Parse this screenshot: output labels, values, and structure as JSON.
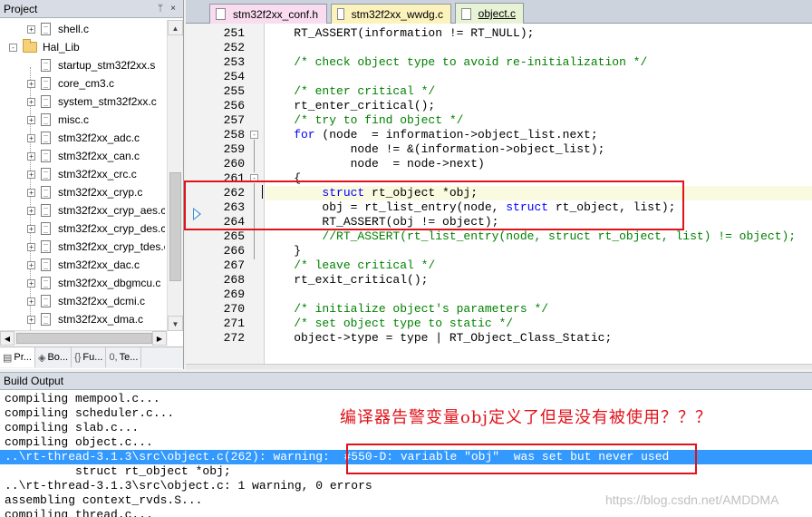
{
  "project_panel": {
    "title": "Project",
    "pin_glyph": "ᛘ",
    "close_glyph": "×",
    "tree": [
      {
        "label": "shell.c",
        "kind": "file",
        "expander": "+"
      },
      {
        "label": "Hal_Lib",
        "kind": "folder",
        "expander": "−"
      },
      {
        "label": "startup_stm32f2xx.s",
        "kind": "file",
        "expander": ""
      },
      {
        "label": "core_cm3.c",
        "kind": "file",
        "expander": "+"
      },
      {
        "label": "system_stm32f2xx.c",
        "kind": "file",
        "expander": "+"
      },
      {
        "label": "misc.c",
        "kind": "file",
        "expander": "+"
      },
      {
        "label": "stm32f2xx_adc.c",
        "kind": "file",
        "expander": "+"
      },
      {
        "label": "stm32f2xx_can.c",
        "kind": "file",
        "expander": "+"
      },
      {
        "label": "stm32f2xx_crc.c",
        "kind": "file",
        "expander": "+"
      },
      {
        "label": "stm32f2xx_cryp.c",
        "kind": "file",
        "expander": "+"
      },
      {
        "label": "stm32f2xx_cryp_aes.c",
        "kind": "file",
        "expander": "+"
      },
      {
        "label": "stm32f2xx_cryp_des.c",
        "kind": "file",
        "expander": "+"
      },
      {
        "label": "stm32f2xx_cryp_tdes.c",
        "kind": "file",
        "expander": "+"
      },
      {
        "label": "stm32f2xx_dac.c",
        "kind": "file",
        "expander": "+"
      },
      {
        "label": "stm32f2xx_dbgmcu.c",
        "kind": "file",
        "expander": "+"
      },
      {
        "label": "stm32f2xx_dcmi.c",
        "kind": "file",
        "expander": "+"
      },
      {
        "label": "stm32f2xx_dma.c",
        "kind": "file",
        "expander": "+"
      }
    ],
    "tabs": [
      {
        "label": "Pr...",
        "icon": "▤"
      },
      {
        "label": "Bo...",
        "icon": "◈"
      },
      {
        "label": "Fu...",
        "icon": "{}"
      },
      {
        "label": "Te...",
        "icon": "0,"
      }
    ]
  },
  "editor": {
    "tabs": [
      {
        "label": "stm32f2xx_conf.h",
        "color": "#f9dcef",
        "active": false
      },
      {
        "label": "stm32f2xx_wwdg.c",
        "color": "#fbf2bc",
        "active": false
      },
      {
        "label": "object.c",
        "color": "#e7f3d4",
        "active": true
      }
    ],
    "lines": [
      {
        "n": "251",
        "parts": [
          [
            "",
            "    RT_ASSERT(information != RT_NULL);"
          ]
        ]
      },
      {
        "n": "252",
        "parts": [
          [
            "",
            ""
          ]
        ]
      },
      {
        "n": "253",
        "parts": [
          [
            "cm",
            "    /* check object type to avoid re-initialization */"
          ]
        ]
      },
      {
        "n": "254",
        "parts": [
          [
            "",
            ""
          ]
        ]
      },
      {
        "n": "255",
        "parts": [
          [
            "cm",
            "    /* enter critical */"
          ]
        ]
      },
      {
        "n": "256",
        "parts": [
          [
            "",
            "    rt_enter_critical();"
          ]
        ]
      },
      {
        "n": "257",
        "parts": [
          [
            "cm",
            "    /* try to find object */"
          ]
        ]
      },
      {
        "n": "258",
        "parts": [
          [
            "kw",
            "    for"
          ],
          [
            "",
            " (node  = information->object_list.next;"
          ]
        ]
      },
      {
        "n": "259",
        "parts": [
          [
            "",
            "            node != &(information->object_list);"
          ]
        ]
      },
      {
        "n": "260",
        "parts": [
          [
            "",
            "            node  = node->next)"
          ]
        ]
      },
      {
        "n": "261",
        "parts": [
          [
            "",
            "    {"
          ]
        ]
      },
      {
        "n": "262",
        "parts": [
          [
            "kw",
            "        struct"
          ],
          [
            "",
            " rt_object *obj;"
          ]
        ],
        "current": true
      },
      {
        "n": "263",
        "parts": [
          [
            "",
            "        obj = rt_list_entry(node, "
          ],
          [
            "kw",
            "struct"
          ],
          [
            "",
            " rt_object, list);"
          ]
        ]
      },
      {
        "n": "264",
        "parts": [
          [
            "",
            "        RT_ASSERT(obj != object);"
          ]
        ]
      },
      {
        "n": "265",
        "parts": [
          [
            "cm",
            "        //RT_ASSERT(rt_list_entry(node, struct rt_object, list) != object);"
          ]
        ]
      },
      {
        "n": "266",
        "parts": [
          [
            "",
            "    }"
          ]
        ]
      },
      {
        "n": "267",
        "parts": [
          [
            "cm",
            "    /* leave critical */"
          ]
        ]
      },
      {
        "n": "268",
        "parts": [
          [
            "",
            "    rt_exit_critical();"
          ]
        ]
      },
      {
        "n": "269",
        "parts": [
          [
            "",
            ""
          ]
        ]
      },
      {
        "n": "270",
        "parts": [
          [
            "cm",
            "    /* initialize object's parameters */"
          ]
        ]
      },
      {
        "n": "271",
        "parts": [
          [
            "cm",
            "    /* set object type to static */"
          ]
        ]
      },
      {
        "n": "272",
        "parts": [
          [
            "",
            "    object->type = type | RT_Object_Class_Static;"
          ]
        ]
      }
    ]
  },
  "build_output": {
    "title": "Build Output",
    "lines": [
      {
        "text": "compiling mempool.c..."
      },
      {
        "text": "compiling scheduler.c..."
      },
      {
        "text": "compiling slab.c..."
      },
      {
        "text": "compiling object.c..."
      },
      {
        "text": "..\\rt-thread-3.1.3\\src\\object.c(262): warning:  #550-D: variable \"obj\"  was set but never used",
        "selected": true
      },
      {
        "text": "          struct rt_object *obj;"
      },
      {
        "text": "..\\rt-thread-3.1.3\\src\\object.c: 1 warning, 0 errors"
      },
      {
        "text": "assembling context_rvds.S..."
      },
      {
        "text": "compiling thread.c..."
      }
    ]
  },
  "annotation": {
    "text": "编译器告警变量obj定义了但是没有被使用？？？",
    "color": "#e0121a"
  },
  "watermark": "https://blog.csdn.net/AMDDMA"
}
